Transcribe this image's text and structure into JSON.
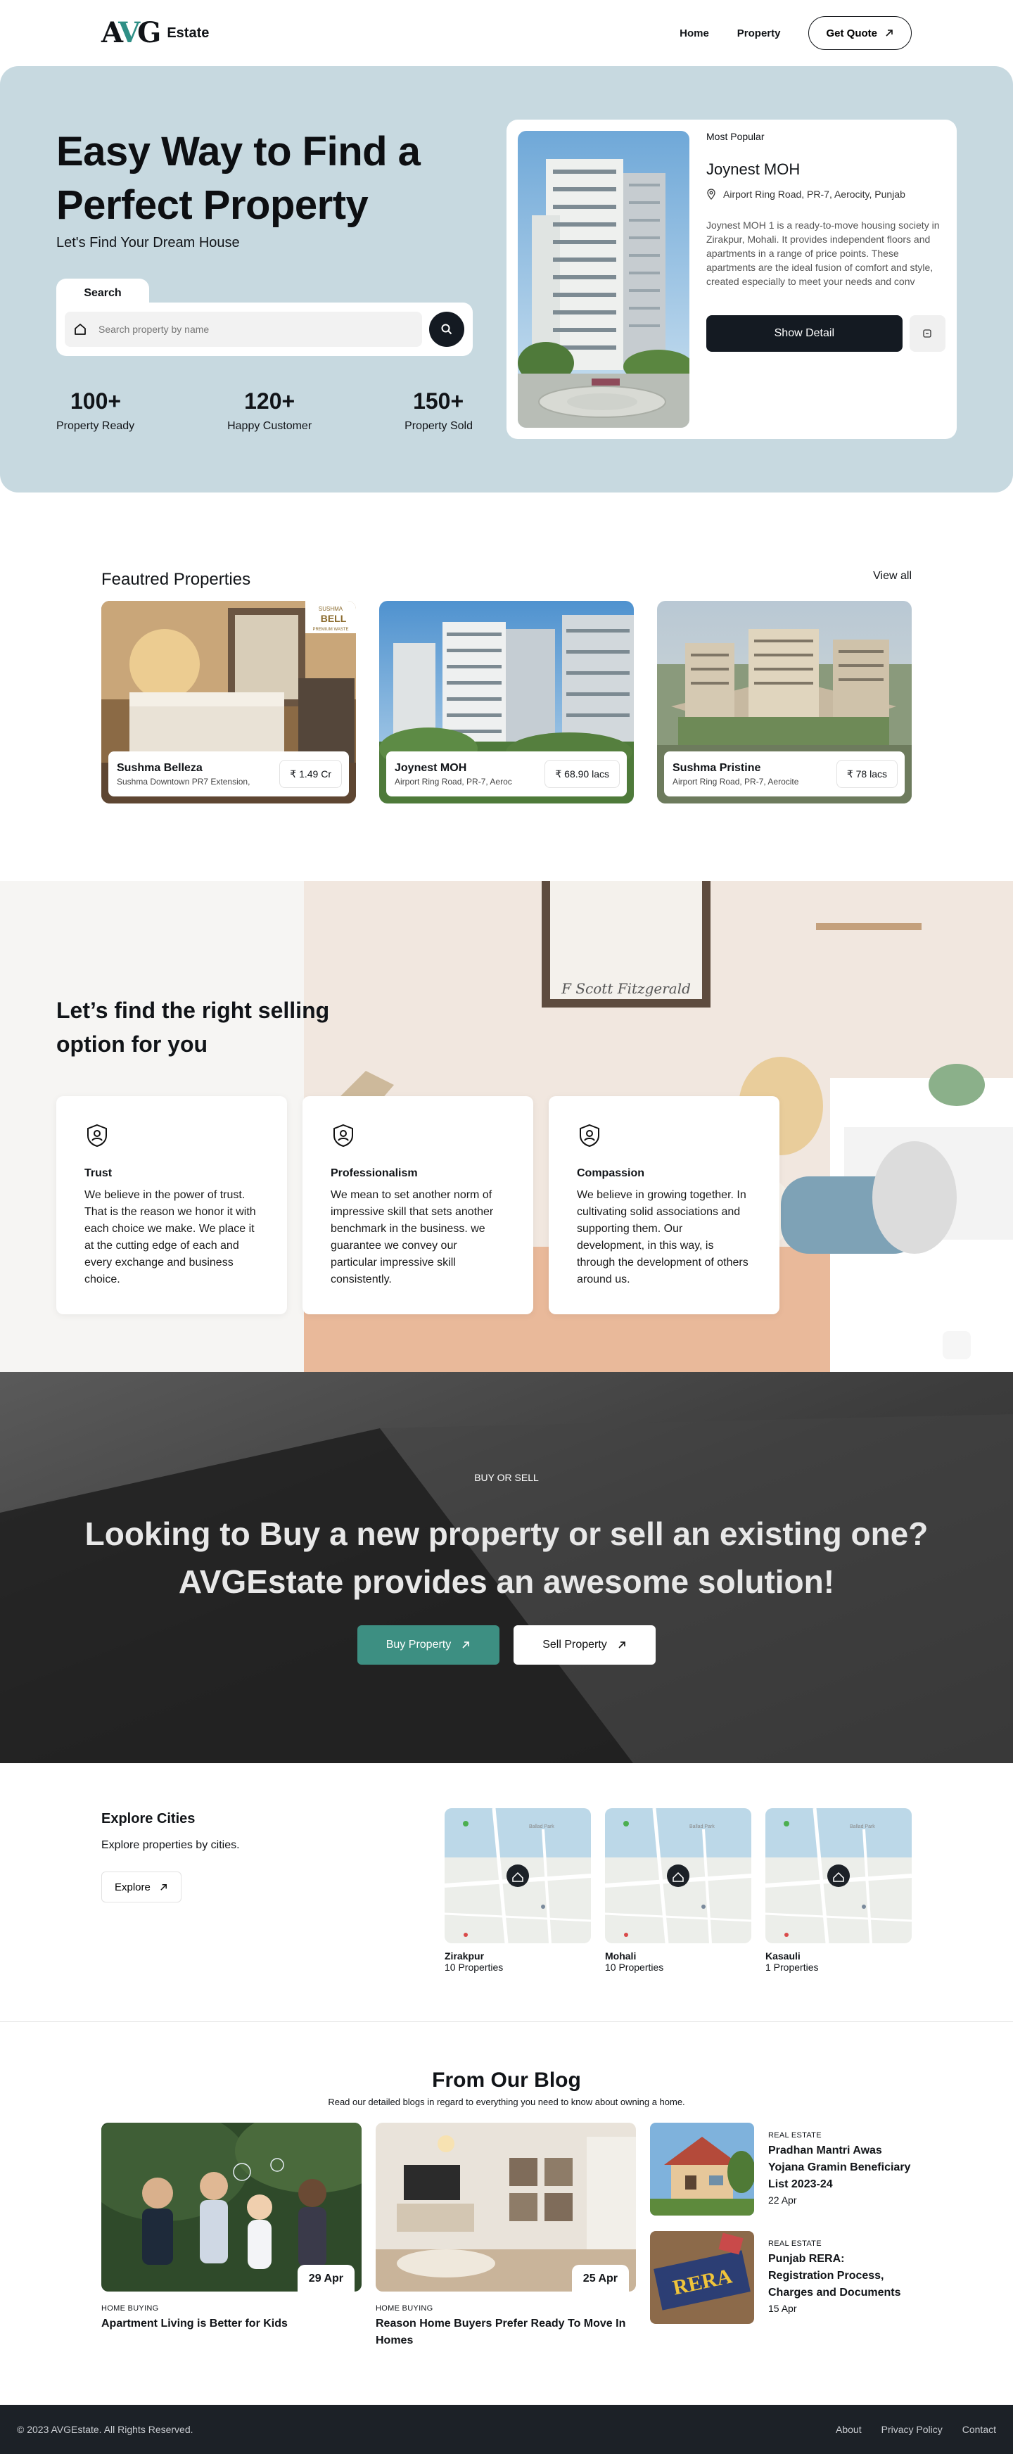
{
  "brand": {
    "mark_a": "A",
    "mark_v": "V",
    "mark_g": "G",
    "name": "Estate"
  },
  "nav": {
    "links": [
      "Home",
      "Property"
    ],
    "cta": "Get Quote"
  },
  "hero": {
    "title": "Easy Way to Find a Perfect Property",
    "subtitle": "Let's Find Your Dream House",
    "search_tab": "Search",
    "search_placeholder": "Search property by name",
    "stats": [
      {
        "value": "100+",
        "label": "Property Ready"
      },
      {
        "value": "120+",
        "label": "Happy Customer"
      },
      {
        "value": "150+",
        "label": "Property Sold"
      }
    ],
    "card": {
      "label": "Most Popular",
      "name": "Joynest MOH",
      "address": "Airport Ring Road, PR-7, Aerocity, Punjab",
      "description": "Joynest MOH 1 is a ready-to-move housing society in Zirakpur, Mohali. It provides independent floors and apartments in a range of price points. These apartments are the ideal fusion of comfort and style, created especially to meet your needs and conv",
      "button": "Show Detail"
    }
  },
  "featured": {
    "title": "Feautred Properties",
    "view_all": "View all",
    "items": [
      {
        "name": "Sushma Belleza",
        "address": "Sushma Downtown PR7 Extension,",
        "price": "₹ 1.49 Cr",
        "badge_1": "SUSHMA",
        "badge_2": "BELL",
        "badge_3": "PREMIUM WASTE"
      },
      {
        "name": "Joynest MOH",
        "address": "Airport Ring Road, PR-7, Aeroc",
        "price": "₹ 68.90 lacs"
      },
      {
        "name": "Sushma Pristine",
        "address": "Airport Ring Road, PR-7, Aerocite",
        "price": "₹ 78 lacs"
      }
    ]
  },
  "selling": {
    "title": "Let’s find the right selling option for you",
    "frame_text": "F Scott Fitzgerald",
    "cards": [
      {
        "title": "Trust",
        "text": "We believe in the power of trust. That is the reason we honor it with each choice we make. We place it at the cutting edge of each and every exchange and business choice."
      },
      {
        "title": "Professionalism",
        "text": "We mean to set another norm of impressive skill that sets another benchmark in the business. we guarantee we convey our particular impressive skill consistently."
      },
      {
        "title": "Compassion",
        "text": "We believe in growing together. In cultivating solid associations and supporting them. Our development, in this way, is through the development of others around us."
      }
    ]
  },
  "buysell": {
    "eyebrow": "BUY OR SELL",
    "title_line1": "Looking to Buy a new property or sell an existing one?",
    "title_line2": "AVGEstate provides an awesome solution!",
    "buy": "Buy Property",
    "sell": "Sell Property"
  },
  "cities": {
    "title": "Explore Cities",
    "subtitle": "Explore properties by cities.",
    "button": "Explore",
    "map_label": "Ballad Park",
    "items": [
      {
        "name": "Zirakpur",
        "count": "10 Properties"
      },
      {
        "name": "Mohali",
        "count": "10 Properties"
      },
      {
        "name": "Kasauli",
        "count": "1 Properties"
      }
    ]
  },
  "blog": {
    "title": "From Our Blog",
    "subtitle": "Read our detailed blogs in regard to everything you need to know about owning a home.",
    "big": [
      {
        "date": "29 Apr",
        "category": "HOME BUYING",
        "title": "Apartment Living is Better for Kids"
      },
      {
        "date": "25 Apr",
        "category": "HOME BUYING",
        "title": "Reason Home Buyers Prefer Ready To Move In Homes"
      }
    ],
    "small": [
      {
        "category": "REAL ESTATE",
        "title": "Pradhan Mantri Awas Yojana Gramin Beneficiary List 2023-24",
        "date": "22 Apr"
      },
      {
        "category": "REAL ESTATE",
        "title": "Punjab RERA: Registration Process, Charges and Documents",
        "date": "15 Apr",
        "image_text": "RERA"
      }
    ]
  },
  "footer": {
    "copyright": "© 2023 AVGEstate. All Rights Reserved.",
    "links": [
      "About",
      "Privacy Policy",
      "Contact"
    ]
  }
}
